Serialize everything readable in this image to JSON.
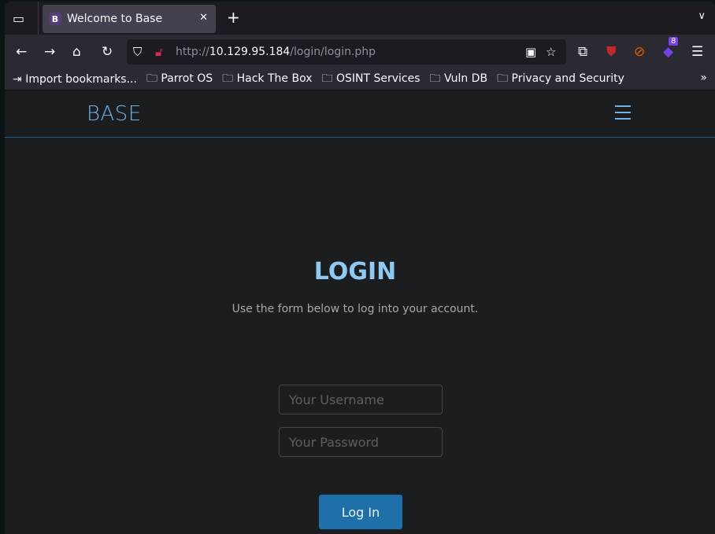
{
  "browser": {
    "tab_title": "Welcome to Base",
    "tab_favicon": "B",
    "url_scheme": "http://",
    "url_host": "10.129.95.184",
    "url_path": "/login/login.php",
    "extension_badge": "8",
    "bookmarks": [
      "Import bookmarks...",
      "Parrot OS",
      "Hack The Box",
      "OSINT Services",
      "Vuln DB",
      "Privacy and Security"
    ]
  },
  "site": {
    "brand": "BASE",
    "title": "LOGIN",
    "subtitle": "Use the form below to log into your account.",
    "username_placeholder": "Your Username",
    "password_placeholder": "Your Password",
    "login_label": "Log In",
    "accent": "#1f6fa9"
  }
}
